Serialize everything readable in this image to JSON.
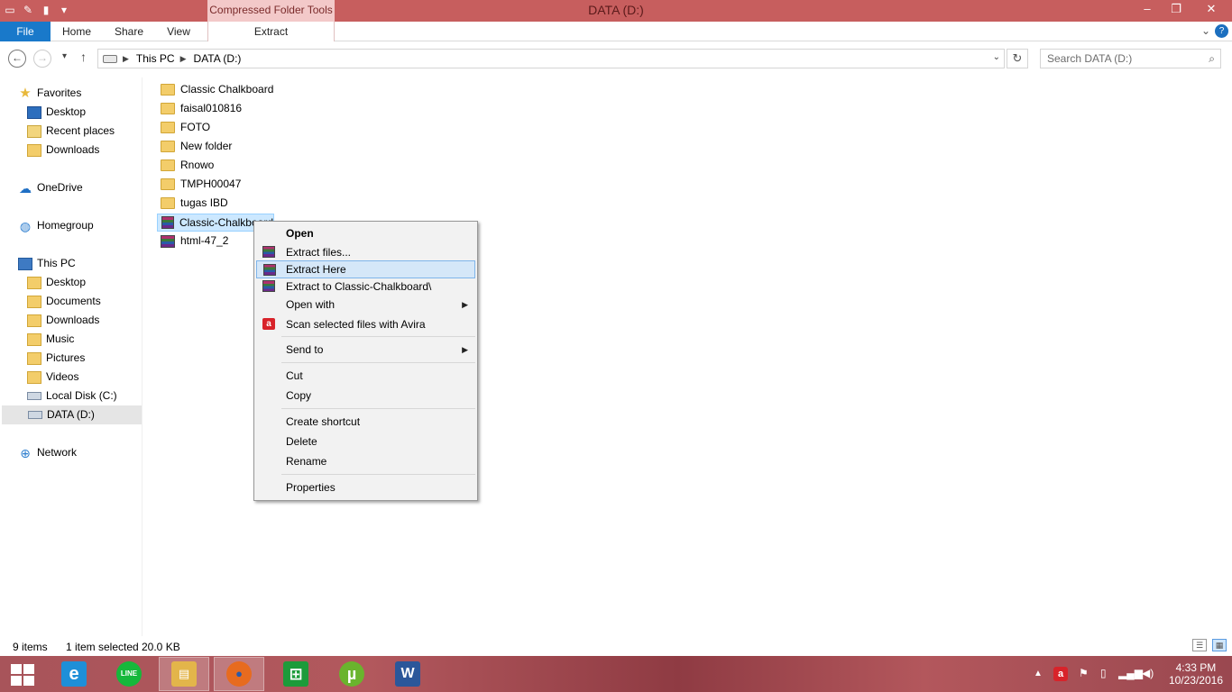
{
  "window": {
    "title": "DATA (D:)",
    "contextual_group": "Compressed Folder Tools",
    "controls": {
      "minimize": "–",
      "maximize": "❐",
      "close": "✕"
    }
  },
  "ribbon": {
    "tabs": [
      "File",
      "Home",
      "Share",
      "View",
      "Extract"
    ],
    "help": "?"
  },
  "address": {
    "crumbs": [
      "This PC",
      "DATA (D:)"
    ],
    "search_placeholder": "Search DATA (D:)"
  },
  "nav": {
    "favorites": {
      "label": "Favorites",
      "items": [
        "Desktop",
        "Recent places",
        "Downloads"
      ]
    },
    "onedrive": "OneDrive",
    "homegroup": "Homegroup",
    "thispc": {
      "label": "This PC",
      "items": [
        "Desktop",
        "Documents",
        "Downloads",
        "Music",
        "Pictures",
        "Videos",
        "Local Disk (C:)",
        "DATA (D:)"
      ]
    },
    "network": "Network"
  },
  "files": [
    {
      "name": "Classic Chalkboard",
      "type": "folder"
    },
    {
      "name": "faisal010816",
      "type": "folder"
    },
    {
      "name": "FOTO",
      "type": "folder"
    },
    {
      "name": "New folder",
      "type": "folder"
    },
    {
      "name": "Rnowo",
      "type": "folder"
    },
    {
      "name": "TMPH00047",
      "type": "folder"
    },
    {
      "name": "tugas IBD",
      "type": "folder"
    },
    {
      "name": "Classic-Chalkboard",
      "type": "archive",
      "selected": true
    },
    {
      "name": "html-47_2",
      "type": "archive"
    }
  ],
  "context_menu": {
    "items": [
      {
        "label": "Open",
        "bold": true
      },
      {
        "label": "Extract files...",
        "icon": "winrar-icon"
      },
      {
        "label": "Extract Here",
        "icon": "winrar-icon",
        "highlighted": true
      },
      {
        "label": "Extract to Classic-Chalkboard\\",
        "icon": "winrar-icon"
      },
      {
        "label": "Open with",
        "submenu": true
      },
      {
        "label": "Scan selected files with Avira",
        "icon": "avira-icon"
      },
      {
        "label": "Send to",
        "submenu": true
      },
      {
        "label": "Cut"
      },
      {
        "label": "Copy"
      },
      {
        "label": "Create shortcut"
      },
      {
        "label": "Delete"
      },
      {
        "label": "Rename"
      },
      {
        "label": "Properties"
      }
    ]
  },
  "status": {
    "count": "9 items",
    "selection": "1 item selected",
    "size": "20.0 KB"
  },
  "taskbar": {
    "apps": [
      {
        "name": "internet-explorer",
        "glyph": "e",
        "color": "#1e8fd8"
      },
      {
        "name": "line",
        "glyph": "LINE",
        "color": "#16b83b"
      },
      {
        "name": "file-explorer",
        "glyph": "▤",
        "color": "#e3b54a",
        "active": true
      },
      {
        "name": "firefox",
        "glyph": "●",
        "color": "#e76b1f",
        "active": true
      },
      {
        "name": "store",
        "glyph": "⊞",
        "color": "#1d9b3a"
      },
      {
        "name": "utorrent",
        "glyph": "µ",
        "color": "#6ab42d"
      },
      {
        "name": "word",
        "glyph": "W",
        "color": "#2b579a"
      }
    ],
    "time": "4:33 PM",
    "date": "10/23/2016"
  }
}
